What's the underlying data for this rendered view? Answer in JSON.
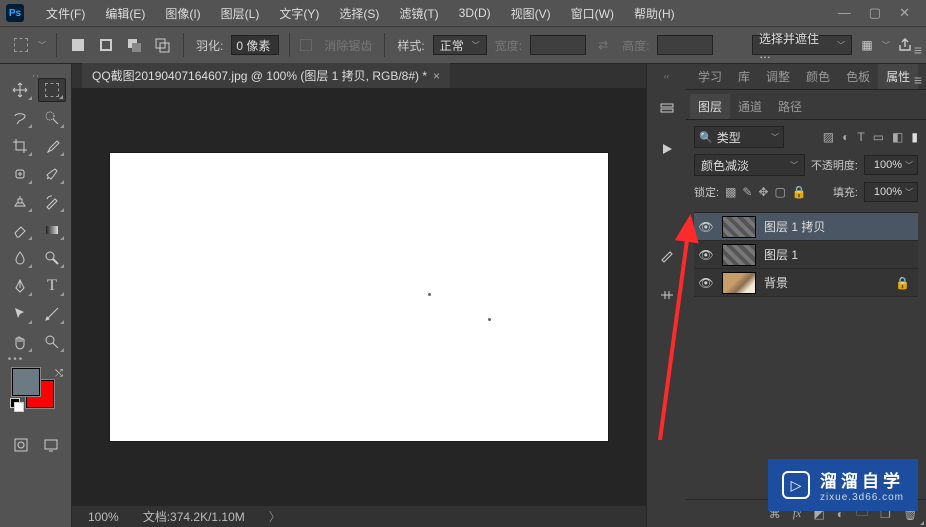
{
  "app": {
    "logo": "Ps"
  },
  "menu": {
    "file": "文件(F)",
    "edit": "编辑(E)",
    "image": "图像(I)",
    "layer": "图层(L)",
    "type": "文字(Y)",
    "select": "选择(S)",
    "filter": "滤镜(T)",
    "threeD": "3D(D)",
    "view": "视图(V)",
    "window": "窗口(W)",
    "help": "帮助(H)"
  },
  "options": {
    "feather_label": "羽化:",
    "feather_value": "0 像素",
    "antialias": "消除锯齿",
    "style_label": "样式:",
    "style_value": "正常",
    "width_label": "宽度:",
    "height_label": "高度:",
    "mask_select": "选择并遮住 …"
  },
  "document": {
    "tab_title": "QQ截图20190407164607.jpg @ 100% (图层 1 拷贝, RGB/8#) *",
    "zoom": "100%",
    "status": "文档:374.2K/1.10M"
  },
  "properties_panel": {
    "tabs": {
      "learn": "学习",
      "library": "库",
      "adjustments": "调整",
      "color": "颜色",
      "swatches": "色板",
      "properties": "属性"
    }
  },
  "layers_panel": {
    "tabs": {
      "layers": "图层",
      "channels": "通道",
      "paths": "路径"
    },
    "kind_label": "类型",
    "blend_mode": "颜色减淡",
    "opacity_label": "不透明度:",
    "opacity_value": "100%",
    "lock_label": "锁定:",
    "fill_label": "填充:",
    "fill_value": "100%",
    "layers": [
      {
        "name": "图层 1 拷贝",
        "locked": false
      },
      {
        "name": "图层 1",
        "locked": false
      },
      {
        "name": "背景",
        "locked": true
      }
    ]
  },
  "watermark": {
    "title": "溜溜自学",
    "sub": "zixue.3d66.com"
  }
}
